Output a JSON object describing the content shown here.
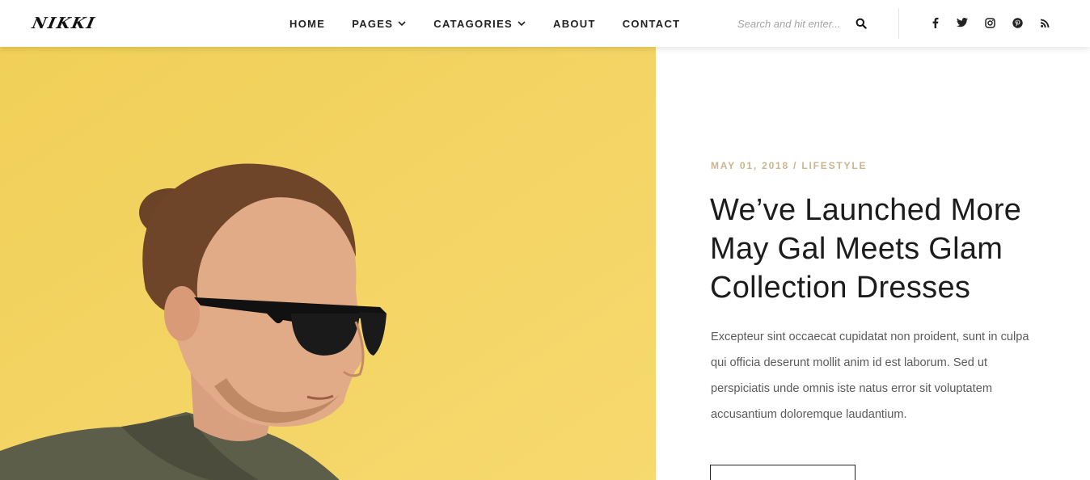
{
  "header": {
    "logo": "NIKKI",
    "nav": [
      {
        "label": "HOME",
        "dropdown": false
      },
      {
        "label": "PAGES",
        "dropdown": true
      },
      {
        "label": "CATAGORIES",
        "dropdown": true
      },
      {
        "label": "ABOUT",
        "dropdown": false
      },
      {
        "label": "CONTACT",
        "dropdown": false
      }
    ],
    "search": {
      "placeholder": "Search and hit enter..."
    },
    "social_icons": [
      "facebook-icon",
      "twitter-icon",
      "instagram-icon",
      "pinterest-icon",
      "rss-icon"
    ]
  },
  "hero": {
    "image": "man-with-sunglasses-photo",
    "background_color": "#f3d25c"
  },
  "article": {
    "meta": "MAY 01, 2018 / LIFESTYLE",
    "title": "We’ve Launched More May Gal Meets Glam Collection Dresses",
    "excerpt": "Excepteur sint occaecat cupidatat non proident, sunt in culpa qui officia deserunt mollit anim id est laborum. Sed ut perspiciatis unde omnis iste natus error sit voluptatem accusantium doloremque laudantium.",
    "meta_color": "#c9b58f"
  }
}
